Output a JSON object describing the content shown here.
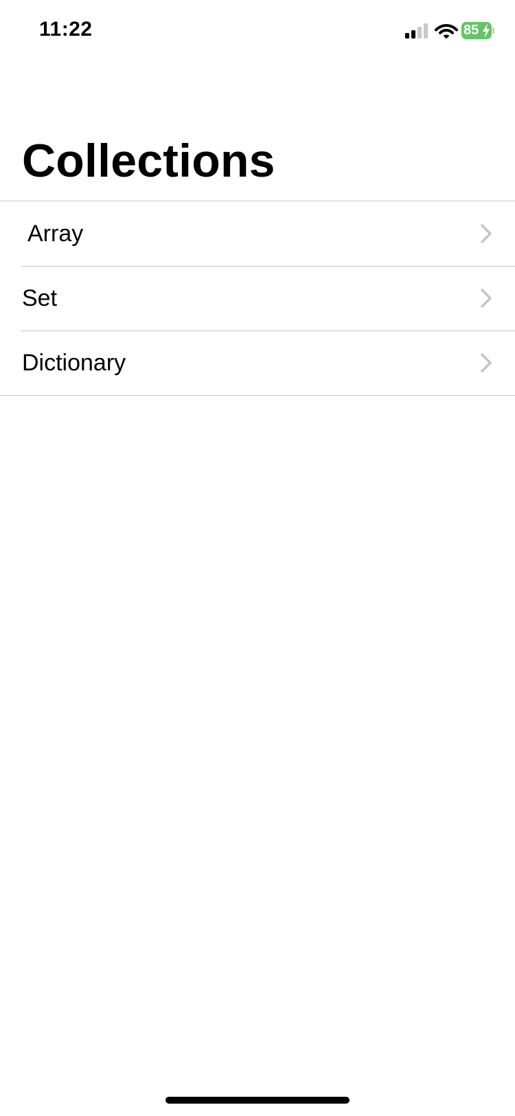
{
  "status_bar": {
    "time": "11:22",
    "battery_percent": "85",
    "battery_color": "#65c466",
    "icons": [
      "cellular-signal-icon",
      "wifi-icon",
      "battery-charging-icon"
    ]
  },
  "navigation": {
    "title": "Collections"
  },
  "list": {
    "items": [
      {
        "label": "Array",
        "icon": "chevron-right-icon"
      },
      {
        "label": "Set",
        "icon": "chevron-right-icon"
      },
      {
        "label": "Dictionary",
        "icon": "chevron-right-icon"
      }
    ],
    "separator_color": "#c6c6c8",
    "chevron_color": "#c4c4c6"
  }
}
